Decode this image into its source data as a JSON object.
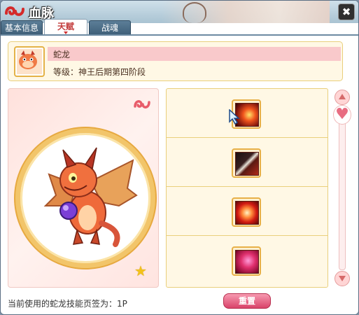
{
  "window": {
    "title": "血脉",
    "close_symbol": "✖",
    "logo_icon": "swirl-logo-icon"
  },
  "tabs": [
    {
      "label": "基本信息",
      "active": false
    },
    {
      "label": "天赋",
      "active": true
    },
    {
      "label": "战魂",
      "active": false
    }
  ],
  "pet": {
    "name": "蛇龙",
    "level_text": "等级：神王后期第四阶段",
    "avatar_icon": "pet-avatar-icon"
  },
  "portrait": {
    "swirl_icon": "swirl-icon",
    "star_symbol": "★"
  },
  "skills": [
    {
      "icon": "fire-strike-skill-icon"
    },
    {
      "icon": "dark-slash-skill-icon"
    },
    {
      "icon": "flame-burst-skill-icon"
    },
    {
      "icon": "crimson-aura-skill-icon"
    }
  ],
  "scrollbar": {
    "thumb_symbol": "♥"
  },
  "footer": {
    "status_text": "当前使用的蛇龙技能页签为：1P",
    "reset_label": "重置"
  },
  "colors": {
    "accent_red": "#d13030",
    "panel_gold": "#e9cf7c",
    "name_band_pink": "#f9c9cb",
    "button_pink": "#d9436a"
  }
}
